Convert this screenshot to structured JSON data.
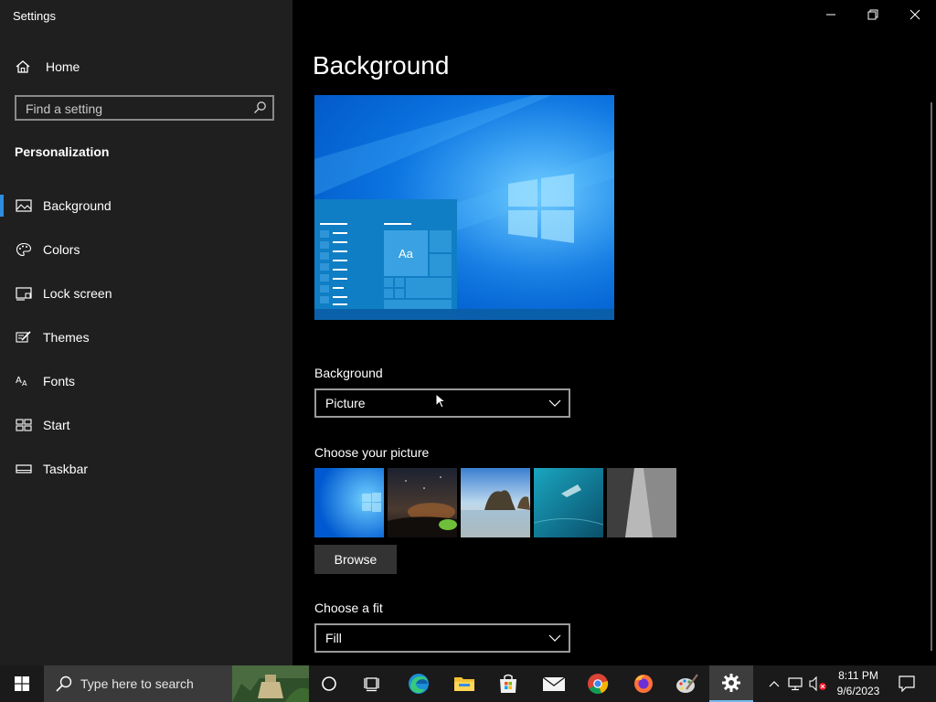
{
  "window": {
    "title": "Settings"
  },
  "sidebar": {
    "home_label": "Home",
    "search_placeholder": "Find a setting",
    "section_title": "Personalization",
    "items": [
      {
        "label": "Background",
        "icon": "picture-icon",
        "active": true
      },
      {
        "label": "Colors",
        "icon": "palette-icon"
      },
      {
        "label": "Lock screen",
        "icon": "lock-screen-icon"
      },
      {
        "label": "Themes",
        "icon": "brush-icon"
      },
      {
        "label": "Fonts",
        "icon": "font-icon"
      },
      {
        "label": "Start",
        "icon": "start-tiles-icon"
      },
      {
        "label": "Taskbar",
        "icon": "taskbar-icon"
      }
    ]
  },
  "main": {
    "page_title": "Background",
    "preview_tile_label": "Aa",
    "background_label": "Background",
    "background_value": "Picture",
    "choose_picture_label": "Choose your picture",
    "browse_label": "Browse",
    "choose_fit_label": "Choose a fit",
    "fit_value": "Fill"
  },
  "taskbar": {
    "search_placeholder": "Type here to search",
    "time": "8:11 PM",
    "date": "9/6/2023"
  },
  "colors": {
    "accent": "#2e8ce0",
    "sidebar_bg": "#1f1f1f",
    "taskbar_bg": "#1a1a1a"
  }
}
